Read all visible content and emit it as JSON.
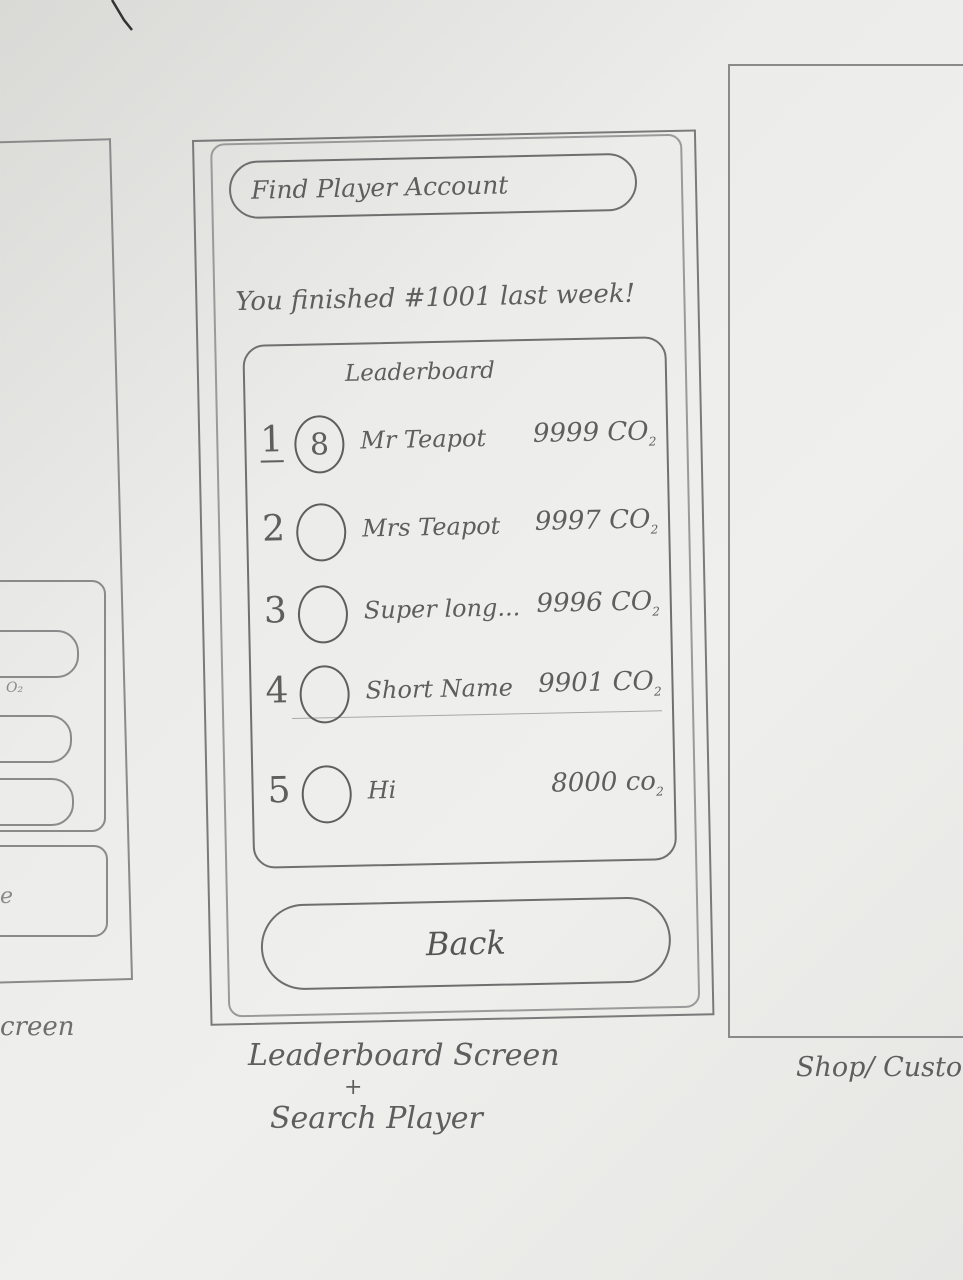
{
  "search": {
    "placeholder": "Find Player Account"
  },
  "status_message": "You finished #1001 last week!",
  "leaderboard": {
    "title": "Leaderboard",
    "rows": [
      {
        "rank": "1",
        "avatar": "8",
        "name": "Mr Teapot",
        "score": "9999 CO",
        "unit_sub": "2"
      },
      {
        "rank": "2",
        "avatar": "",
        "name": "Mrs Teapot",
        "score": "9997 CO",
        "unit_sub": "2"
      },
      {
        "rank": "3",
        "avatar": "",
        "name": "Super long...",
        "score": "9996 CO",
        "unit_sub": "2"
      },
      {
        "rank": "4",
        "avatar": "",
        "name": "Short Name",
        "score": "9901 CO",
        "unit_sub": "2"
      },
      {
        "rank": "5",
        "avatar": "",
        "name": "Hi",
        "score": "8000 co",
        "unit_sub": "2"
      }
    ]
  },
  "back_button": "Back",
  "caption": {
    "line1": "Leaderboard Screen",
    "plus": "+",
    "line2": "Search Player"
  },
  "left_caption": "creen",
  "right_caption": "Shop/ Custo",
  "left_fragments": {
    "unit": "O₂",
    "letter": "e"
  }
}
